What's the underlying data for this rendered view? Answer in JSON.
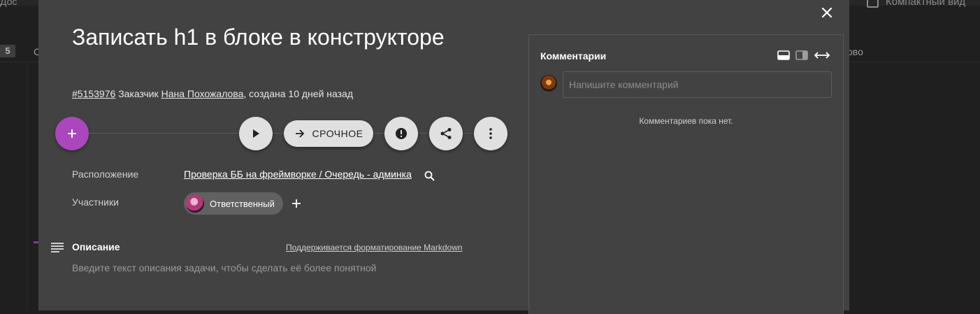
{
  "background": {
    "doc_label": "Дос",
    "column_count": "5",
    "column_letter": "С",
    "status_partial": "ово",
    "compact_view": "Компактный вид"
  },
  "task": {
    "title": "Записать h1 в блоке в конструкторе",
    "id": "#5153976",
    "customer_prefix": "Заказчик",
    "customer_name": "Нана Похожалова",
    "created": ", создана 10 дней назад"
  },
  "toolbar": {
    "urgent_label": "СРОЧНОЕ",
    "accent_color": "#ab47bc"
  },
  "fields": {
    "location_label": "Расположение",
    "location_value": "Проверка ББ на фреймворке / Очередь - админка",
    "participants_label": "Участники",
    "participant_role": "Ответственный"
  },
  "description": {
    "title": "Описание",
    "markdown_hint": "Поддерживается форматирование Markdown",
    "placeholder": "Введите текст описания задачи, чтобы сделать её более понятной"
  },
  "comments": {
    "title": "Комментарии",
    "input_placeholder": "Напишите комментарий",
    "empty_text": "Комментариев пока нет."
  }
}
